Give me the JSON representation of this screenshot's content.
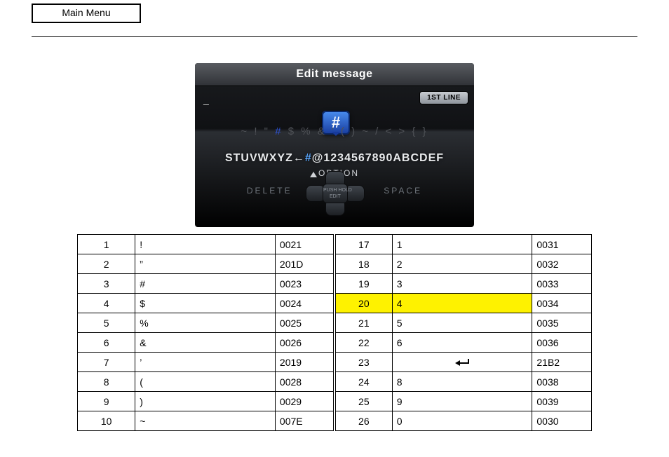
{
  "top_button": {
    "label": "Main Menu"
  },
  "device": {
    "title": "Edit message",
    "cursor": "_",
    "line_badge": "1ST LINE",
    "balloon_char": "#",
    "row_secondary_left": "~ ! \"",
    "row_secondary_highlight": "#",
    "row_secondary_right": "$ % & ' ( ) ~ / < > { }",
    "row_primary_left": "STUVWXYZ←",
    "row_primary_highlight": "#",
    "row_primary_right": "@1234567890ABCDEF",
    "option_label": "OPTION",
    "delete_label": "DELETE",
    "space_label": "SPACE",
    "hub_label": "PUSH HOLD\nEDIT"
  },
  "table": {
    "rows": [
      {
        "l_no": "1",
        "l_char": "!",
        "l_u": "0021",
        "r_no": "17",
        "r_char": "1",
        "r_u": "0031"
      },
      {
        "l_no": "2",
        "l_char": "”",
        "l_u": "201D",
        "r_no": "18",
        "r_char": "2",
        "r_u": "0032"
      },
      {
        "l_no": "3",
        "l_char": "#",
        "l_u": "0023",
        "r_no": "19",
        "r_char": "3",
        "r_u": "0033"
      },
      {
        "l_no": "4",
        "l_char": "$",
        "l_u": "0024",
        "r_no": "20",
        "r_char": "4",
        "r_u": "0034",
        "highlight": true
      },
      {
        "l_no": "5",
        "l_char": "%",
        "l_u": "0025",
        "r_no": "21",
        "r_char": "5",
        "r_u": "0035"
      },
      {
        "l_no": "6",
        "l_char": "&",
        "l_u": "0026",
        "r_no": "22",
        "r_char": "6",
        "r_u": "0036"
      },
      {
        "l_no": "7",
        "l_char": "’",
        "l_u": "2019",
        "r_no": "23",
        "r_char": "_ARROW_",
        "r_u": "21B2"
      },
      {
        "l_no": "8",
        "l_char": "(",
        "l_u": "0028",
        "r_no": "24",
        "r_char": "8",
        "r_u": "0038"
      },
      {
        "l_no": "9",
        "l_char": ")",
        "l_u": "0029",
        "r_no": "25",
        "r_char": "9",
        "r_u": "0039"
      },
      {
        "l_no": "10",
        "l_char": "~",
        "l_u": "007E",
        "r_no": "26",
        "r_char": "0",
        "r_u": "0030"
      }
    ]
  }
}
